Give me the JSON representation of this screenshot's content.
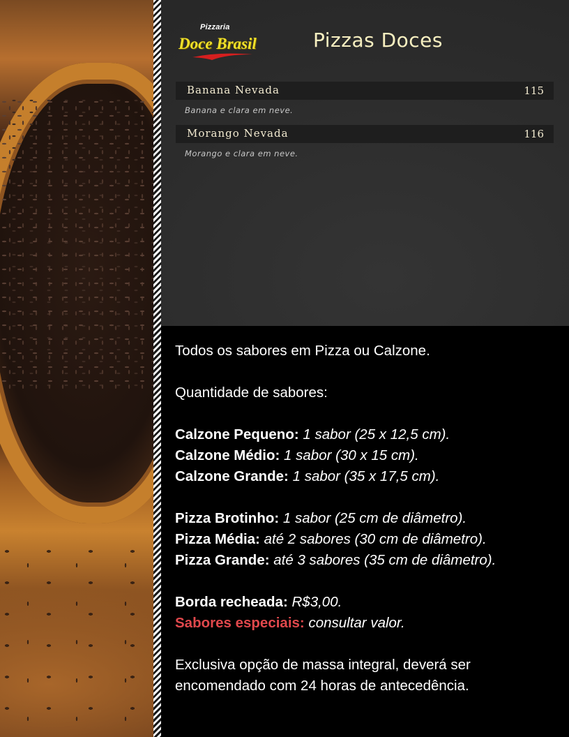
{
  "logo": {
    "top_text": "Pizzaria",
    "main_text": "Doce Brasil"
  },
  "page_title": "Pizzas Doces",
  "menu_items": [
    {
      "name": "Banana Nevada",
      "code": "115",
      "description": "Banana e clara em neve."
    },
    {
      "name": "Morango Nevada",
      "code": "116",
      "description": "Morango e clara em neve."
    }
  ],
  "info": {
    "intro": "Todos os sabores em Pizza ou Calzone.",
    "quantity_heading": "Quantidade de sabores:",
    "calzone_sizes": [
      {
        "label": "Calzone Pequeno:",
        "value": "1 sabor (25 x 12,5 cm)."
      },
      {
        "label": "Calzone Médio:",
        "value": "1 sabor (30 x 15 cm)."
      },
      {
        "label": "Calzone Grande:",
        "value": "1 sabor (35 x 17,5 cm)."
      }
    ],
    "pizza_sizes": [
      {
        "label": "Pizza Brotinho:",
        "value": "1 sabor (25 cm de diâmetro)."
      },
      {
        "label": "Pizza Média:",
        "value": "até 2 sabores (30 cm de diâmetro)."
      },
      {
        "label": "Pizza Grande:",
        "value": "até 3 sabores (35 cm de diâmetro)."
      }
    ],
    "border": {
      "label": "Borda recheada:",
      "value": "R$3,00."
    },
    "special": {
      "label": "Sabores especiais:",
      "value": "consultar valor."
    },
    "note_line1": "Exclusiva opção de massa integral, deverá ser",
    "note_line2": "encomendado com 24 horas de antecedência."
  },
  "colors": {
    "title": "#f7efc0",
    "logo_yellow": "#f0e02a",
    "logo_red": "#d61f1f",
    "special_red": "#e0484c",
    "panel_dark": "#2c2c2c",
    "item_bar": "#1e1e1e"
  }
}
